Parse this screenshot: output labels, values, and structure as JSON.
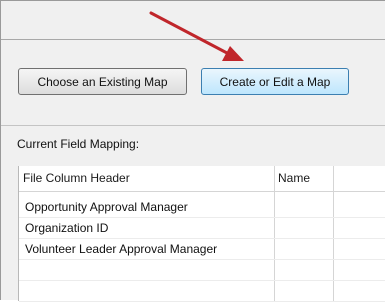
{
  "buttons": {
    "choose_existing": "Choose an Existing Map",
    "create_edit": "Create or Edit a Map"
  },
  "section": {
    "label": "Current Field Mapping:"
  },
  "table": {
    "columns": [
      "File Column Header",
      "Name"
    ],
    "rows": [
      "Opportunity Approval Manager",
      "Organization ID",
      "Volunteer Leader Approval Manager"
    ]
  },
  "annotation": {
    "arrow_color": "#c0262b"
  }
}
